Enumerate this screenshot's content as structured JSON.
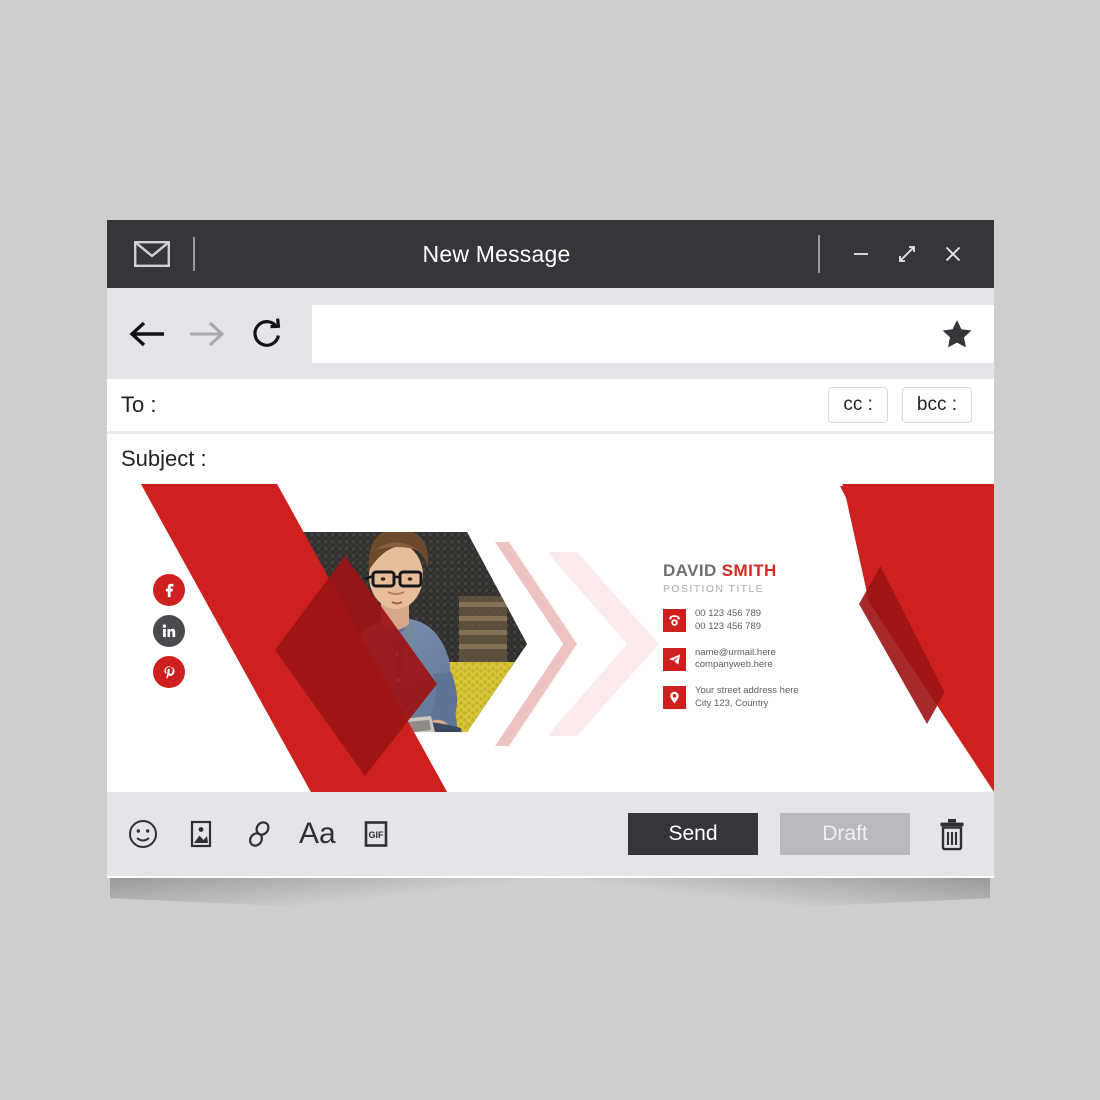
{
  "window": {
    "title": "New Message",
    "app_icon": "envelope-icon",
    "controls": {
      "minimize": "minimize-icon",
      "maximize": "maximize-icon",
      "close": "close-icon"
    }
  },
  "nav": {
    "back": "back-arrow-icon",
    "forward": "forward-arrow-icon",
    "reload": "reload-icon",
    "address_value": "",
    "address_placeholder": "",
    "bookmark": "star-icon"
  },
  "compose": {
    "to_label": "To :",
    "cc_label": "cc :",
    "bcc_label": "bcc :",
    "subject_label": "Subject :",
    "to_value": "",
    "subject_value": ""
  },
  "signature": {
    "name_first": "DAVID",
    "name_last": "SMITH",
    "position": "POSITION TITLE",
    "contacts": [
      {
        "icon": "phone-icon",
        "line1": "00 123 456 789",
        "line2": "00 123 456 789"
      },
      {
        "icon": "paper-plane-icon",
        "line1": "name@urmail.here",
        "line2": "companyweb.here"
      },
      {
        "icon": "location-pin-icon",
        "line1": "Your street address here",
        "line2": "City 123, Country"
      }
    ],
    "social": [
      {
        "name": "facebook-icon",
        "label": "f",
        "color": "#cf2020"
      },
      {
        "name": "linkedin-icon",
        "label": "in",
        "color": "#4a4a50"
      },
      {
        "name": "pinterest-icon",
        "label": "P",
        "color": "#cf2020"
      }
    ],
    "photo_alt": "man-with-glasses-reading-photo"
  },
  "toolbar": {
    "icons": [
      {
        "name": "emoji-icon",
        "label": "emoji"
      },
      {
        "name": "image-icon",
        "label": "image"
      },
      {
        "name": "link-icon",
        "label": "link"
      },
      {
        "name": "text-format-icon",
        "label": "Aa"
      },
      {
        "name": "gif-icon",
        "label": "GIF"
      }
    ],
    "send_label": "Send",
    "draft_label": "Draft",
    "delete": "trash-icon"
  },
  "colors": {
    "titlebar": "#35353a",
    "navbar": "#e4e4e9",
    "accent_red": "#cf2020",
    "accent_dark_red": "#9c1313",
    "page_background": "#cecece",
    "send_button": "#35353a",
    "draft_button": "#b8b8bd"
  }
}
